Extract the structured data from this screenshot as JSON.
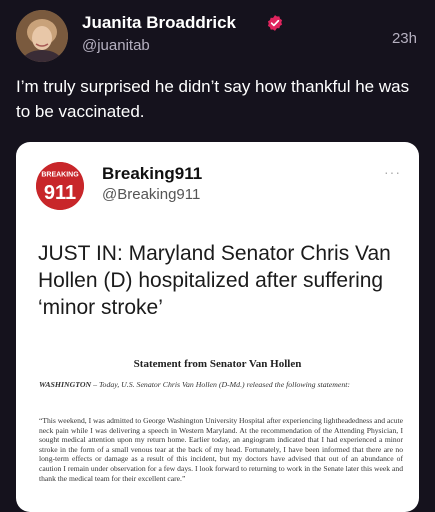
{
  "post": {
    "author_name": "Juanita Broaddrick",
    "handle": "@juanitab",
    "time": "23h",
    "text": "I’m truly surprised he didn’t say how thankful he was to be vaccinated."
  },
  "embed": {
    "avatar_text_top": "BREAKING",
    "avatar_text_main": "911",
    "author_name": "Breaking911",
    "handle": "@Breaking911",
    "more": "···",
    "headline": "JUST IN: Maryland Senator Chris Van Hollen (D) hospitalized after suffering ‘minor stroke’",
    "statement_title": "Statement from Senator Van Hollen",
    "dateline_place": "WASHINGTON",
    "dateline_rest": " – Today, U.S. Senator Chris Van Hollen (D-Md.) released the following statement:",
    "statement_body": "“This weekend, I was admitted to George Washington University Hospital after experiencing lightheadedness and acute neck pain while I was delivering a speech in Western Maryland. At the recommendation of the Attending Physician, I sought medical attention upon my return home. Earlier today, an angiogram indicated that I had experienced a minor stroke in the form of a small venous tear at the back of my head. Fortunately, I have been informed that there are no long-term effects or damage as a result of this incident, but my doctors have advised that out of an abundance of caution I remain under observation for a few days. I look forward to returning to work in the Senate later this week and thank the medical team for their excellent care.”"
  },
  "colors": {
    "background": "#15121d",
    "verified": "#e0245e",
    "secondary_text": "#b5b0c0",
    "embed_background": "#ffffff",
    "embed_avatar": "#c8262a"
  },
  "icons": {
    "verified": "verified-badge-icon",
    "more": "more-options-icon"
  }
}
